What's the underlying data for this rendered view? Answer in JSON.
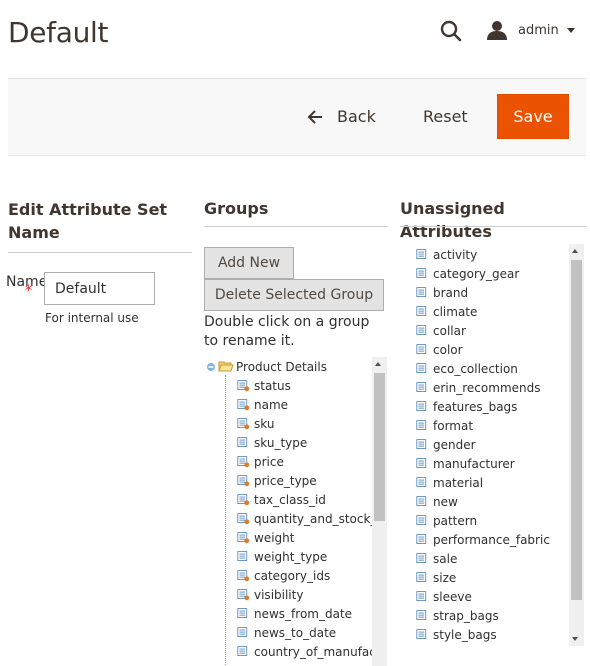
{
  "header": {
    "title": "Default",
    "user_label": "admin"
  },
  "actions": {
    "back_label": "Back",
    "reset_label": "Reset",
    "save_label": "Save",
    "save_color": "#eb5202"
  },
  "edit_name": {
    "title": "Edit Attribute Set Name",
    "field_label": "Name",
    "value": "Default",
    "note": "For internal use"
  },
  "groups": {
    "title": "Groups",
    "add_new_label": "Add New",
    "delete_label": "Delete Selected Group",
    "hint": "Double click on a group to rename it.",
    "tree": {
      "group_name": "Product Details",
      "items": [
        {
          "label": "status",
          "system": true
        },
        {
          "label": "name",
          "system": true
        },
        {
          "label": "sku",
          "system": true
        },
        {
          "label": "sku_type",
          "system": false
        },
        {
          "label": "price",
          "system": true
        },
        {
          "label": "price_type",
          "system": true
        },
        {
          "label": "tax_class_id",
          "system": true
        },
        {
          "label": "quantity_and_stock_s",
          "system": true
        },
        {
          "label": "weight",
          "system": true
        },
        {
          "label": "weight_type",
          "system": false
        },
        {
          "label": "category_ids",
          "system": true
        },
        {
          "label": "visibility",
          "system": true
        },
        {
          "label": "news_from_date",
          "system": false
        },
        {
          "label": "news_to_date",
          "system": false
        },
        {
          "label": "country_of_manufact",
          "system": false
        }
      ]
    }
  },
  "unassigned": {
    "title": "Unassigned Attributes",
    "items": [
      "activity",
      "category_gear",
      "brand",
      "climate",
      "collar",
      "color",
      "eco_collection",
      "erin_recommends",
      "features_bags",
      "format",
      "gender",
      "manufacturer",
      "material",
      "new",
      "pattern",
      "performance_fabric",
      "sale",
      "size",
      "sleeve",
      "strap_bags",
      "style_bags"
    ]
  }
}
